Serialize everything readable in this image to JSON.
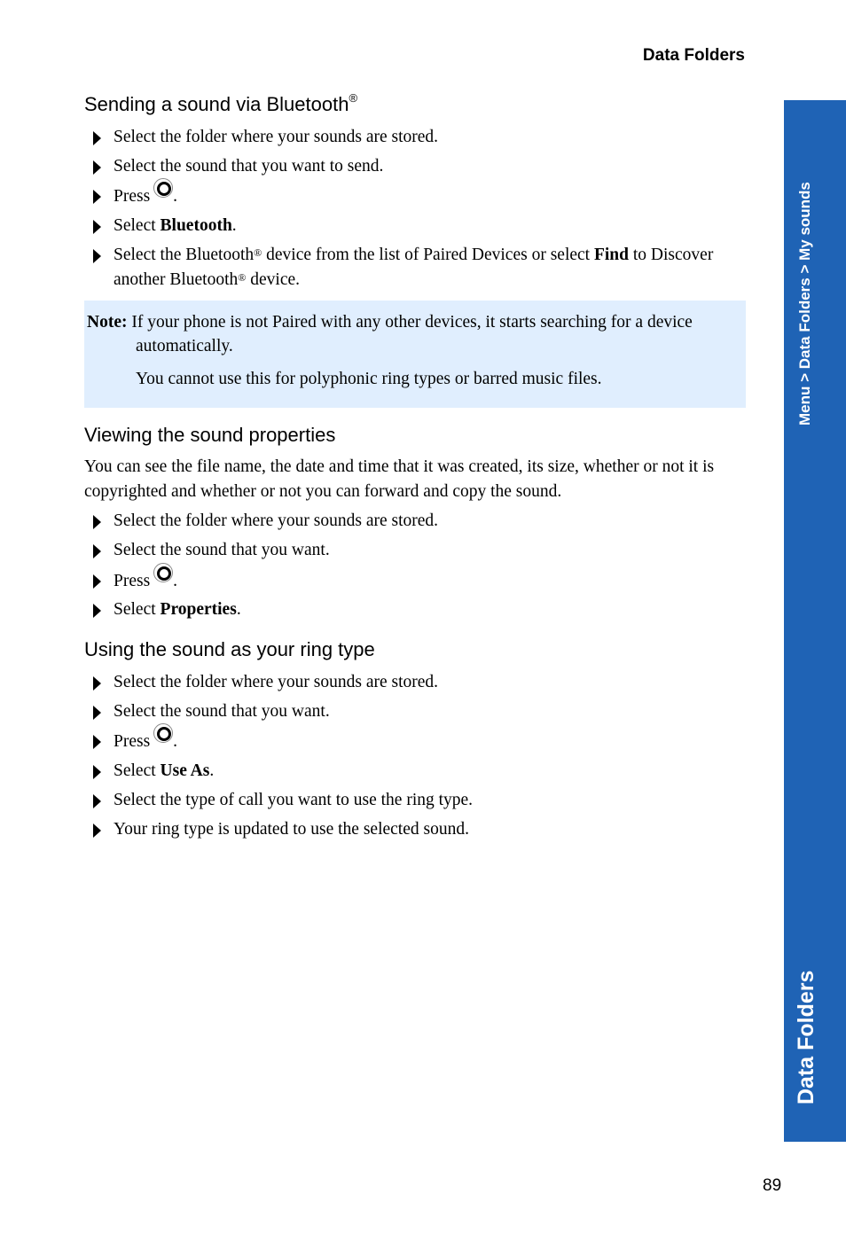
{
  "header": {
    "running_title": "Data Folders"
  },
  "side_tab": {
    "breadcrumb": "Menu > Data Folders > My sounds",
    "chapter_title": "Data Folders",
    "color": "#1f63b5"
  },
  "sections": {
    "bluetooth": {
      "heading": "Sending a sound via Bluetooth",
      "heading_mark": "®",
      "steps": {
        "s1": "Select the folder where your sounds are stored.",
        "s2": "Select the sound that you want to send.",
        "s3_pre": "Press",
        "s3_post": ".",
        "s4_pre": "Select ",
        "s4_bold": "Bluetooth",
        "s4_post": ".",
        "s5_a": "Select the Bluetooth",
        "s5_mark1": "®",
        "s5_b": " device from the list of Paired Devices or select ",
        "s5_bold": "Find",
        "s5_c": " to Discover another Bluetooth",
        "s5_mark2": "®",
        "s5_d": " device."
      }
    },
    "note": {
      "label": "Note:",
      "line1": " If your phone is not Paired with any other devices, it starts searching for a device",
      "line2": "automatically.",
      "line3": "You cannot use this for polyphonic ring types or barred music files.",
      "background": "#e0eefe"
    },
    "properties": {
      "heading": "Viewing the sound properties",
      "intro": "You can see the file name, the date and time that it was created, its size, whether or not it is copyrighted and whether or not you can forward and copy the sound.",
      "steps": {
        "s1": "Select the folder where your sounds are stored.",
        "s2": "Select the sound that you want.",
        "s3_pre": "Press",
        "s3_post": ".",
        "s4_pre": "Select ",
        "s4_bold": "Properties",
        "s4_post": "."
      }
    },
    "ring_type": {
      "heading": "Using the sound as your ring type",
      "steps": {
        "s1": "Select the folder where your sounds are stored.",
        "s2": "Select the sound that you want.",
        "s3_pre": "Press",
        "s3_post": ".",
        "s4_pre": "Select ",
        "s4_bold": "Use As",
        "s4_post": ".",
        "s5": "Select the type of call you want to use the ring type.",
        "s6": "Your ring type is updated to use the selected sound."
      }
    }
  },
  "footer": {
    "page_number": "89"
  }
}
